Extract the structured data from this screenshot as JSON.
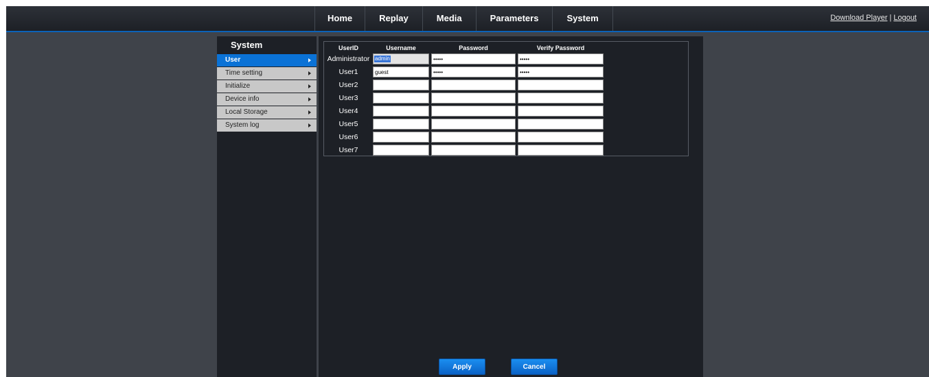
{
  "nav": {
    "items": [
      "Home",
      "Replay",
      "Media",
      "Parameters",
      "System"
    ],
    "download_label": "Download Player",
    "separator": "|",
    "logout_label": "Logout"
  },
  "sidebar": {
    "title": "System",
    "items": [
      {
        "label": "User",
        "active": true
      },
      {
        "label": "Time setting",
        "active": false
      },
      {
        "label": "Initialize",
        "active": false
      },
      {
        "label": "Device info",
        "active": false
      },
      {
        "label": "Local Storage",
        "active": false
      },
      {
        "label": "System log",
        "active": false
      }
    ]
  },
  "user_table": {
    "headers": {
      "userid": "UserID",
      "username": "Username",
      "password": "Password",
      "verify": "Verify Password"
    },
    "rows": [
      {
        "userid": "Administrator",
        "username": "admin",
        "password": "admin",
        "verify": "admin"
      },
      {
        "userid": "User1",
        "username": "guest",
        "password": "guest",
        "verify": "guest"
      },
      {
        "userid": "User2",
        "username": "",
        "password": "",
        "verify": ""
      },
      {
        "userid": "User3",
        "username": "",
        "password": "",
        "verify": ""
      },
      {
        "userid": "User4",
        "username": "",
        "password": "",
        "verify": ""
      },
      {
        "userid": "User5",
        "username": "",
        "password": "",
        "verify": ""
      },
      {
        "userid": "User6",
        "username": "",
        "password": "",
        "verify": ""
      },
      {
        "userid": "User7",
        "username": "",
        "password": "",
        "verify": ""
      }
    ]
  },
  "buttons": {
    "apply_label": "Apply",
    "cancel_label": "Cancel"
  },
  "colors": {
    "accent": "#0a72d6",
    "topbar_border": "#0b62b9",
    "panel_bg": "#1d2026",
    "page_bg": "#3f434a"
  }
}
